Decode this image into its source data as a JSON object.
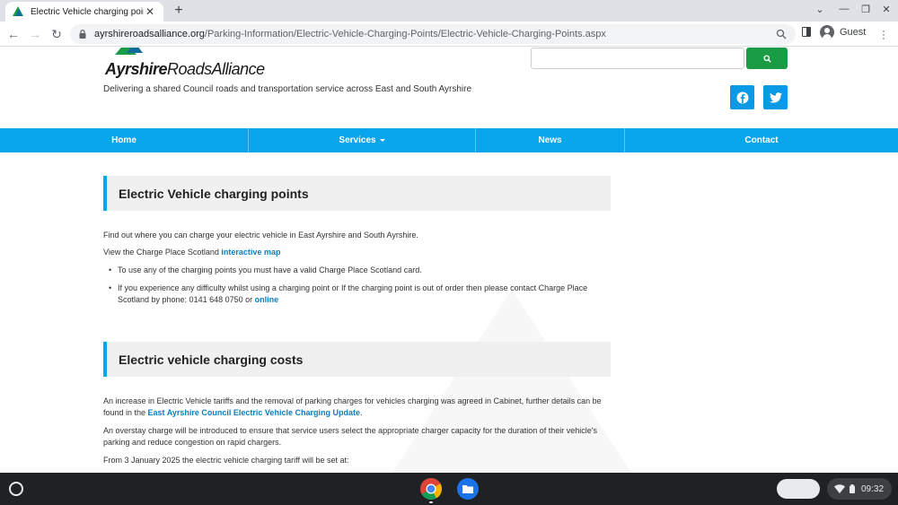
{
  "browser": {
    "tab_title": "Electric Vehicle charging points",
    "url_host": "ayrshireroadsalliance.org",
    "url_path": "/Parking-Information/Electric-Vehicle-Charging-Points/Electric-Vehicle-Charging-Points.aspx",
    "profile_label": "Guest"
  },
  "header": {
    "logo_text_bold": "Ayrshire",
    "logo_text_rest": "RoadsAlliance",
    "tagline": "Delivering a shared Council roads and transportation service across East and South Ayrshire",
    "search_placeholder": "",
    "social_colors": {
      "facebook": "#0a9ae5",
      "twitter": "#0a9ae5"
    }
  },
  "nav": {
    "items": [
      {
        "label": "Home"
      },
      {
        "label": "Services"
      },
      {
        "label": "News"
      },
      {
        "label": "Contact"
      }
    ],
    "color": "#08a5ec"
  },
  "content": {
    "section1": {
      "heading": "Electric Vehicle charging points",
      "intro": "Find out where you can charge your electric vehicle in East Ayrshire and South Ayrshire.",
      "map_prefix": "View the Charge Place Scotland ",
      "map_link": "interactive map",
      "bullet1": "To use any of the charging points you must have a valid Charge Place Scotland card.",
      "bullet2_text": "If you experience any difficulty whilst using a charging point or If the charging point is out of order then please contact Charge Place Scotland by phone: 0141 648 0750 or ",
      "bullet2_link": "online"
    },
    "section2": {
      "heading": "Electric vehicle charging costs",
      "para1_text": "An increase in Electric Vehicle tariffs and the removal of parking charges for vehicles charging was agreed in Cabinet, further details can be found in the ",
      "para1_link": "East Ayrshire Council  Electric Vehicle Charging Update",
      "para1_end": ".",
      "para2": "An overstay charge will be introduced to ensure that service users select the appropriate charger capacity for the duration of their vehicle's parking and reduce congestion on rapid chargers.",
      "para3": "From 3 January 2025 the electric vehicle charging tariff will be set at:"
    }
  },
  "shelf": {
    "time": "09:32"
  }
}
